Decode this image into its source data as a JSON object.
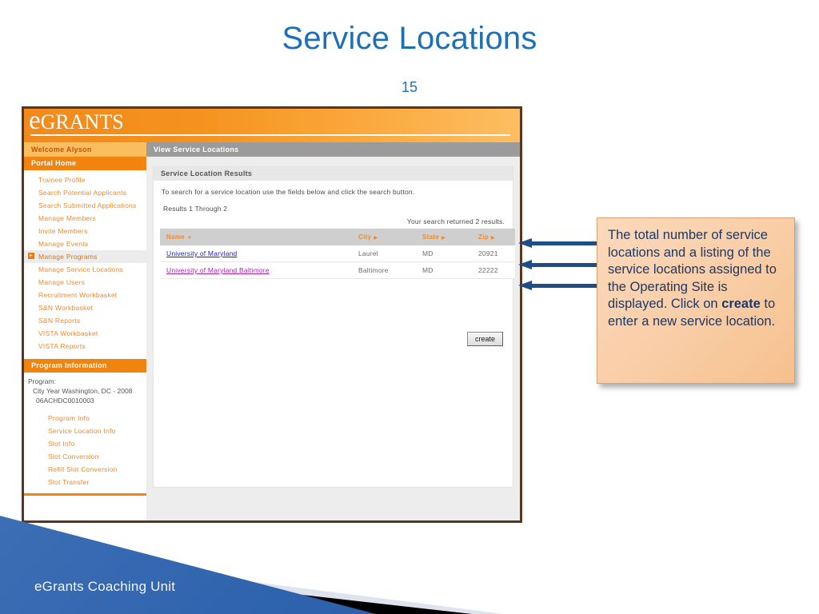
{
  "slide": {
    "title": "Service Locations",
    "number": "15",
    "title_color": "#1F6FB5"
  },
  "app": {
    "logo_e": "e",
    "logo_rest": "GRANTS",
    "welcome": "Welcome Alyson",
    "portal_home": "Portal Home"
  },
  "sidebar": {
    "items": [
      {
        "label": "Trainee Profile",
        "selected": false
      },
      {
        "label": "Search Potential Applicants",
        "selected": false
      },
      {
        "label": "Search Submitted Applications",
        "selected": false
      },
      {
        "label": "Manage Members",
        "selected": false
      },
      {
        "label": "Invite Members",
        "selected": false
      },
      {
        "label": "Manage Events",
        "selected": false
      },
      {
        "label": "Manage Programs",
        "selected": true
      },
      {
        "label": "Manage Service Locations",
        "selected": false
      },
      {
        "label": "Manage Users",
        "selected": false
      },
      {
        "label": "Recruitment Workbasket",
        "selected": false
      },
      {
        "label": "S&N Workbasket",
        "selected": false
      },
      {
        "label": "S&N Reports",
        "selected": false
      },
      {
        "label": "VISTA Workbasket",
        "selected": false
      },
      {
        "label": "VISTA Reports",
        "selected": false
      }
    ]
  },
  "program_information": {
    "header": "Program Information",
    "program_label": "Program:",
    "program_name": "City Year Washington, DC - 2008",
    "program_code": "06ACHDC0010003",
    "links": [
      {
        "label": "Program Info"
      },
      {
        "label": "Service Location Info"
      },
      {
        "label": "Slot Info"
      },
      {
        "label": "Slot Conversion"
      },
      {
        "label": "Refill Slot Conversion"
      },
      {
        "label": "Slot Transfer"
      }
    ]
  },
  "main": {
    "page_header": "View Service Locations",
    "results_header": "Service Location Results",
    "search_help": "To search for a service location use the fields below and click the search button.",
    "results_range": "Results 1 Through 2",
    "results_returned": "Your search returned 2 results.",
    "create_button": "create",
    "table": {
      "columns": [
        {
          "label": "Name",
          "sort": "▼"
        },
        {
          "label": "City",
          "sort": "▶"
        },
        {
          "label": "State",
          "sort": "▶"
        },
        {
          "label": "Zip",
          "sort": "▶"
        }
      ],
      "rows": [
        {
          "name": "University of Maryland",
          "city": "Laurel",
          "state": "MD",
          "zip": "20921",
          "visited": false
        },
        {
          "name": "University of Maryland Baltimore",
          "city": "Baltimore",
          "state": "MD",
          "zip": "22222",
          "visited": true
        }
      ]
    }
  },
  "callout": {
    "text_part1": "The total number of service locations and a listing of the service locations assigned to the Operating Site is displayed. Click on ",
    "emphasis": "create",
    "text_part2": " to enter a new service location.",
    "background": "#F9CDA6",
    "text_color": "#1F3864"
  },
  "arrows": {
    "color": "#1F4E86",
    "count": 3
  },
  "footer": {
    "label": "eGrants Coaching Unit",
    "accent_color": "#2E63AD"
  }
}
